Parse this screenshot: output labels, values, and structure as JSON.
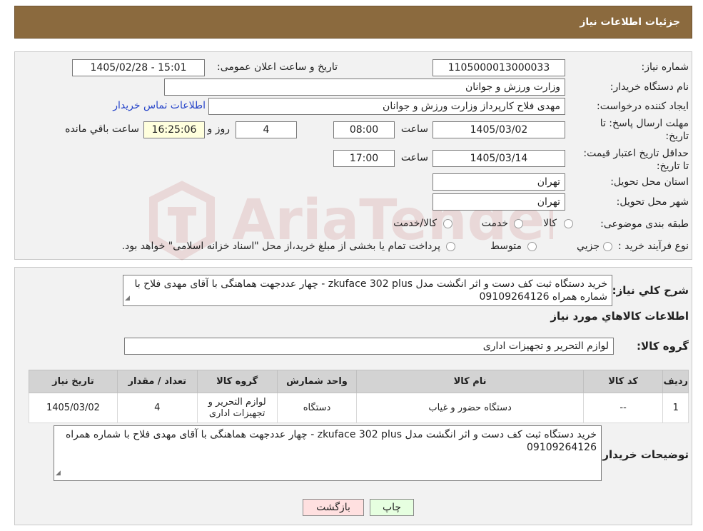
{
  "header": {
    "title": "جزئیات اطلاعات نیاز"
  },
  "labels": {
    "need_number": "شماره نیاز:",
    "announce_datetime": "تاریخ و ساعت اعلان عمومی:",
    "buyer_org": "نام دستگاه خریدار:",
    "requester": "ایجاد کننده درخواست:",
    "reply_deadline": "مهلت ارسال پاسخ: تا تاریخ:",
    "time": "ساعت",
    "days_and": "روز و",
    "remaining": "ساعت باقي مانده",
    "price_validity": "حداقل تاریخ اعتبار قیمت: تا تاریخ:",
    "province": "استان محل تحویل:",
    "city": "شهر محل تحویل:",
    "category": "طبقه بندی موضوعی:",
    "purchase_type": "نوع فرآیند خرید :",
    "need_description": "شرح کلي نیاز:",
    "goods_info": "اطلاعات کالاهاي مورد نیاز",
    "goods_group": "گروه کالا:",
    "buyer_notes": "توضیحات خریدار:"
  },
  "values": {
    "need_number": "1105000013000033",
    "announce_datetime": "1405/02/28 - 15:01",
    "buyer_org": "وزارت ورزش و جوانان",
    "requester": "مهدی فلاح کارپرداز وزارت ورزش و جوانان",
    "contact_link": "اطلاعات تماس خریدار",
    "reply_date": "1405/03/02",
    "reply_time": "08:00",
    "days": "4",
    "remaining_time": "16:25:06",
    "validity_date": "1405/03/14",
    "validity_time": "17:00",
    "province": "تهران",
    "city": "تهران",
    "need_description": "خرید دستگاه ثبت کف دست و اثر انگشت مدل zkuface 302 plus - چهار عددجهت هماهنگی با آقای مهدی فلاح با شماره همراه 09109264126",
    "goods_group": "لوازم التحریر و تجهیزات اداری",
    "buyer_notes": "خرید دستگاه ثبت کف دست و اثر انگشت مدل zkuface 302 plus - چهار عددجهت هماهنگی با آقای مهدی فلاح با شماره همراه 09109264126"
  },
  "category_options": [
    "کالا",
    "خدمت",
    "کالا/خدمت"
  ],
  "purchase_options": [
    "جزیي",
    "متوسط"
  ],
  "purchase_note": "پرداخت تمام یا بخشی از مبلغ خرید،از محل \"اسناد خزانه اسلامی\" خواهد بود.",
  "table": {
    "headers": [
      "ردیف",
      "کد کالا",
      "نام کالا",
      "واحد شمارش",
      "گروه کالا",
      "تعداد / مقدار",
      "تاریخ نیاز"
    ],
    "rows": [
      [
        "1",
        "--",
        "دستگاه حضور و غیاب",
        "دستگاه",
        "لوازم التحریر و تجهیزات اداری",
        "4",
        "1405/03/02"
      ]
    ]
  },
  "buttons": {
    "print": "چاپ",
    "back": "بازگشت"
  },
  "colors": {
    "header_bg": "#8b6a3e",
    "link": "#2745c9",
    "back_button": "#ffe0e0",
    "print_button": "#e6ffe0",
    "remaining_bg": "#ffffdd"
  },
  "watermark": "AriaTender.neT"
}
